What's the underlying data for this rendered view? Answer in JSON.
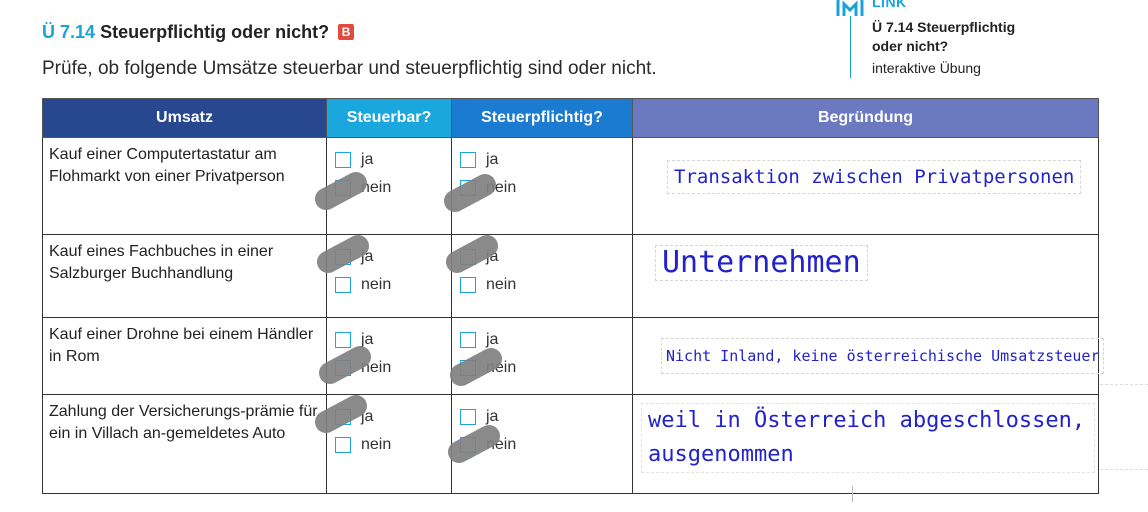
{
  "exercise": {
    "number": "Ü 7.14",
    "title": "Steuerpflichtig oder nicht?",
    "level_badge": "B",
    "instruction": "Prüfe, ob folgende Umsätze steuerbar und steuerpflichtig sind oder nicht."
  },
  "link_box": {
    "label": "LINK",
    "title_line1": "Ü 7.14 Steuerpflichtig",
    "title_line2": "oder nicht?",
    "subtitle": "interaktive Übung"
  },
  "table": {
    "headers": {
      "umsatz": "Umsatz",
      "steuerbar": "Steuerbar?",
      "steuerpflichtig": "Steuerpflichtig?",
      "begruendung": "Begründung"
    },
    "option_yes": "ja",
    "option_no": "nein",
    "rows": [
      {
        "umsatz": "Kauf einer Computertastatur am Flohmarkt von einer Privatperson",
        "steuerbar_marked": "nein",
        "steuerpflichtig_marked": "nein",
        "begruendung": "Transaktion zwischen Privatpersonen"
      },
      {
        "umsatz": "Kauf eines Fachbuches in einer Salzburger Buchhandlung",
        "steuerbar_marked": "ja",
        "steuerpflichtig_marked": "ja",
        "begruendung": "Unternehmen"
      },
      {
        "umsatz": "Kauf einer Drohne bei einem Händler in Rom",
        "steuerbar_marked": "nein",
        "steuerpflichtig_marked": "nein",
        "begruendung": "Nicht Inland,  keine österreichische Umsatzsteuer"
      },
      {
        "umsatz": "Zahlung der Versicherungs-prämie für ein in Villach an-gemeldetes Auto",
        "steuerbar_marked": "ja",
        "steuerpflichtig_marked": "nein",
        "begruendung": "weil in Österreich abgeschlossen, ausgenommen"
      }
    ]
  },
  "colors": {
    "header_umsatz": "#27478f",
    "header_steuerbar": "#19a7de",
    "header_steuerpflichtig": "#1a7bd1",
    "header_begruendung": "#6b79c1",
    "handwriting": "#2222cc",
    "accent": "#1aa3d9",
    "badge": "#e04a3f"
  }
}
